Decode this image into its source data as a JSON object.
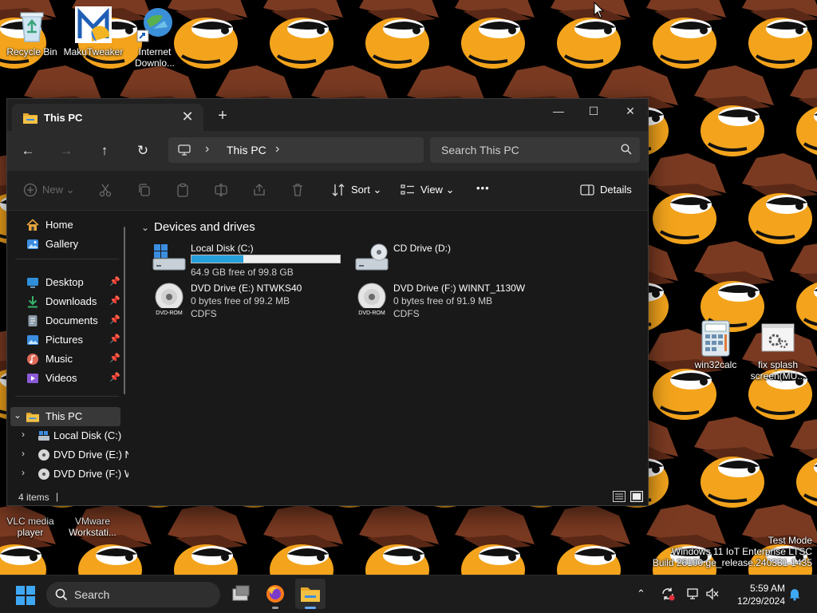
{
  "desktop": {
    "icons_top": [
      {
        "label": "Recycle Bin",
        "icon": "recycle-bin-icon"
      },
      {
        "label": "MakuTweaker",
        "icon": "makutweaker-icon"
      },
      {
        "label": "Internet Downlo...",
        "icon": "internet-download-manager-icon"
      }
    ],
    "icons_bottom": [
      {
        "label": "VLC media player",
        "icon": "vlc-icon"
      },
      {
        "label": "VMware Workstati...",
        "icon": "vmware-icon"
      }
    ],
    "icons_right": [
      {
        "label": "win32calc",
        "icon": "calculator-icon"
      },
      {
        "label": "fix splash screen(MU...",
        "icon": "settings-file-icon"
      }
    ],
    "watermark": {
      "line1": "Test Mode",
      "line2": "Windows 11 IoT Enterprise LTSC",
      "line3": "Build 26100.ge_release.240331-1435"
    }
  },
  "explorer": {
    "tab_title": "This PC",
    "close_tab": "✕",
    "new_tab": "+",
    "window_buttons": {
      "minimize": "—",
      "maximize": "☐",
      "close": "✕"
    },
    "address": {
      "crumb": "This PC",
      "sep": "›"
    },
    "search_placeholder": "Search This PC",
    "commands": {
      "new": "New",
      "sort": "Sort",
      "view": "View",
      "more": "•••",
      "details": "Details"
    },
    "sidebar": {
      "top": [
        {
          "label": "Home",
          "icon": "home-icon"
        },
        {
          "label": "Gallery",
          "icon": "gallery-icon"
        }
      ],
      "pinned": [
        {
          "label": "Desktop",
          "icon": "desktop-icon",
          "color": "#2f8fd8"
        },
        {
          "label": "Downloads",
          "icon": "downloads-icon",
          "color": "#38b26a"
        },
        {
          "label": "Documents",
          "icon": "documents-icon",
          "color": "#8c9aa8"
        },
        {
          "label": "Pictures",
          "icon": "pictures-icon",
          "color": "#3b8de0"
        },
        {
          "label": "Music",
          "icon": "music-icon",
          "color": "#e06a5a"
        },
        {
          "label": "Videos",
          "icon": "videos-icon",
          "color": "#8a5ad6"
        }
      ],
      "this_pc": "This PC",
      "children": [
        {
          "label": "Local Disk (C:)",
          "icon": "local-disk-icon"
        },
        {
          "label": "DVD Drive (E:) N",
          "icon": "dvd-icon"
        },
        {
          "label": "DVD Drive (F:) W",
          "icon": "dvd-icon"
        }
      ]
    },
    "group": "Devices and drives",
    "drives": [
      {
        "name": "Local Disk (C:)",
        "line1": "64.9 GB free of 99.8 GB",
        "used_fraction": 0.35,
        "icon": "local-disk-icon"
      },
      {
        "name": "CD Drive (D:)",
        "icon": "cd-drive-icon"
      },
      {
        "name": "DVD Drive (E:) NTWKS40",
        "line1": "0 bytes free of 99.2 MB",
        "line2": "CDFS",
        "icon": "dvd-rom-icon",
        "badge": "DVD-ROM"
      },
      {
        "name": "DVD Drive (F:) WINNT_1130W",
        "line1": "0 bytes free of 91.9 MB",
        "line2": "CDFS",
        "icon": "dvd-rom-icon",
        "badge": "DVD-ROM"
      }
    ],
    "status": {
      "count": "4 items",
      "cursor": "|"
    }
  },
  "taskbar": {
    "search_placeholder": "Search",
    "apps": [
      "task-view-icon",
      "firefox-icon",
      "file-explorer-icon"
    ],
    "time": "5:59 AM",
    "date": "12/29/2024"
  },
  "colors": {
    "accent": "#26a0da",
    "folder": "#f4c144"
  }
}
